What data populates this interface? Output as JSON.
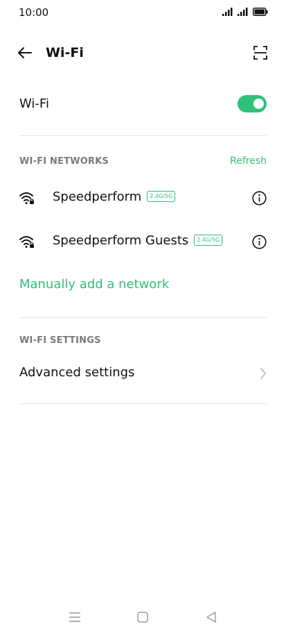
{
  "status_bar": {
    "time": "10:00",
    "icons": [
      "signal-icon",
      "signal-icon",
      "battery-icon"
    ]
  },
  "header": {
    "title": "Wi-Fi",
    "back_icon": "back-arrow-icon",
    "scan_icon": "qr-scan-icon"
  },
  "wifi_toggle": {
    "label": "Wi-Fi",
    "enabled": true
  },
  "networks_section": {
    "header": "WI-FI NETWORKS",
    "refresh_label": "Refresh",
    "items": [
      {
        "name": "Speedperform",
        "band": "2.4G/5G",
        "icon": "wifi-locked-icon"
      },
      {
        "name": "Speedperform Guests",
        "band": "2.4G/5G",
        "icon": "wifi-locked-icon"
      }
    ],
    "add_network_label": "Manually add a network"
  },
  "settings_section": {
    "header": "WI-FI SETTINGS",
    "advanced_label": "Advanced settings"
  },
  "nav_bar": {
    "icons": [
      "menu-icon",
      "home-icon",
      "back-triangle-icon"
    ]
  },
  "colors": {
    "accent": "#2fc07a",
    "section_header": "#7a7a7a",
    "divider": "#e3e3e3",
    "text": "#111111"
  }
}
